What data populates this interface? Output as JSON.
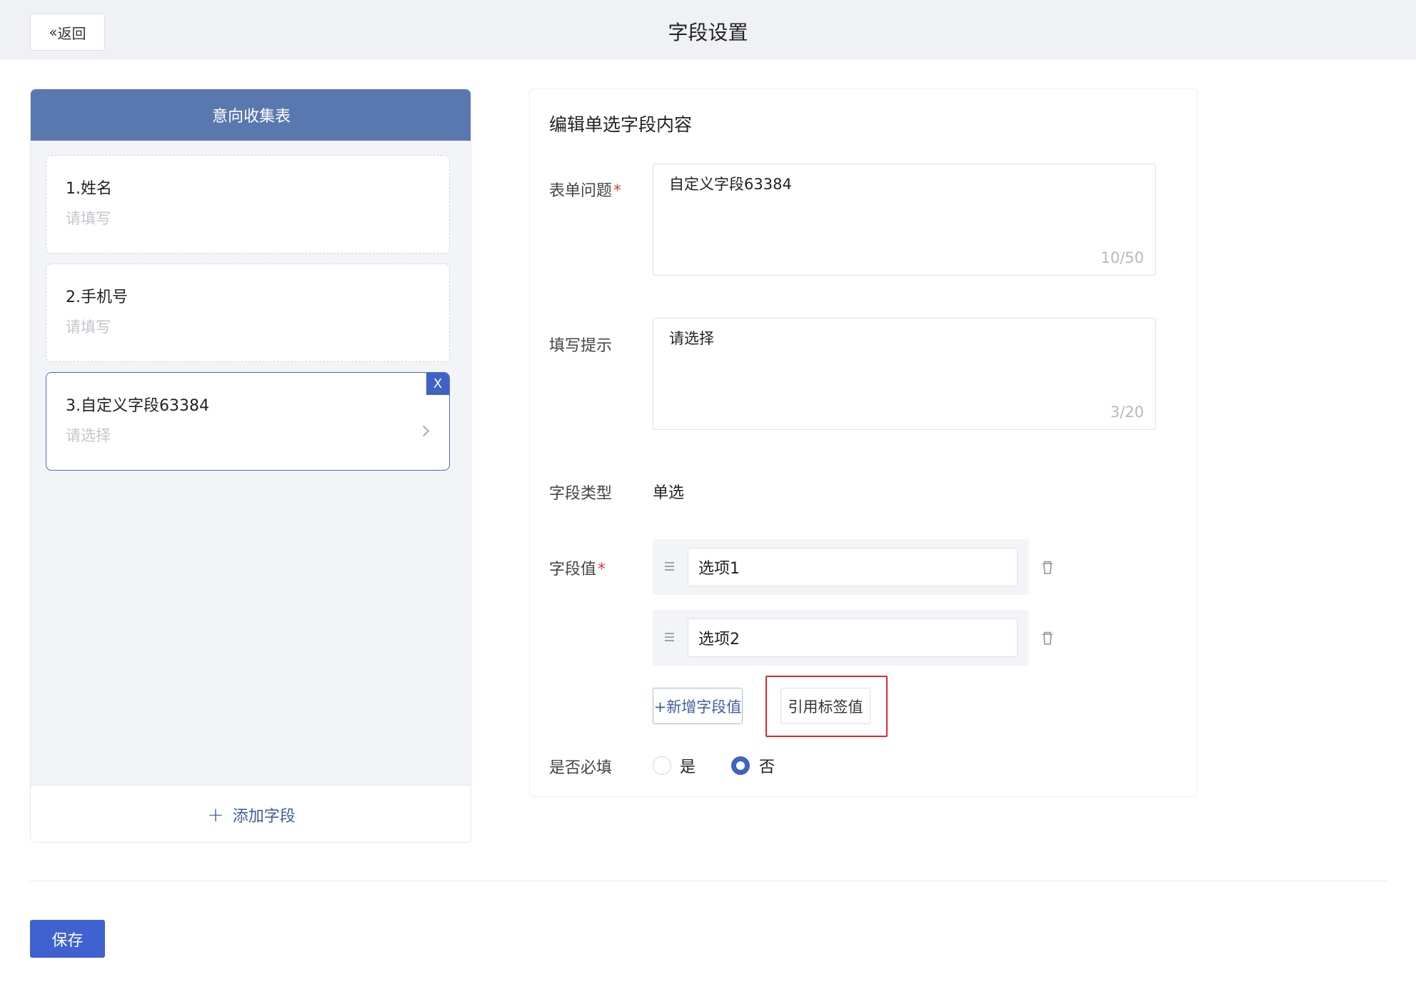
{
  "header": {
    "back_label": "返回",
    "title": "字段设置"
  },
  "preview": {
    "form_title": "意向收集表",
    "fields": [
      {
        "title": "1.姓名",
        "placeholder": "请填写"
      },
      {
        "title": "2.手机号",
        "placeholder": "请填写"
      },
      {
        "title": "3.自定义字段63384",
        "placeholder": "请选择",
        "selected": true
      }
    ],
    "close_label": "X",
    "add_field_label": "添加字段"
  },
  "editor": {
    "title": "编辑单选字段内容",
    "question": {
      "label": "表单问题",
      "required_mark": "*",
      "value": "自定义字段63384",
      "count": "10/50"
    },
    "hint": {
      "label": "填写提示",
      "value": "请选择",
      "count": "3/20"
    },
    "field_type": {
      "label": "字段类型",
      "value": "单选"
    },
    "field_values": {
      "label": "字段值",
      "required_mark": "*",
      "options": [
        "选项1",
        "选项2"
      ],
      "add_label": "+新增字段值",
      "ref_tag_label": "引用标签值"
    },
    "required_setting": {
      "label": "是否必填",
      "yes_label": "是",
      "no_label": "否",
      "selected": "否"
    }
  },
  "footer": {
    "save_label": "保存"
  },
  "colors": {
    "primary": "#3f62d0",
    "preview_header": "#5a78b0",
    "highlight": "#e3262b",
    "required": "#e0393e"
  }
}
